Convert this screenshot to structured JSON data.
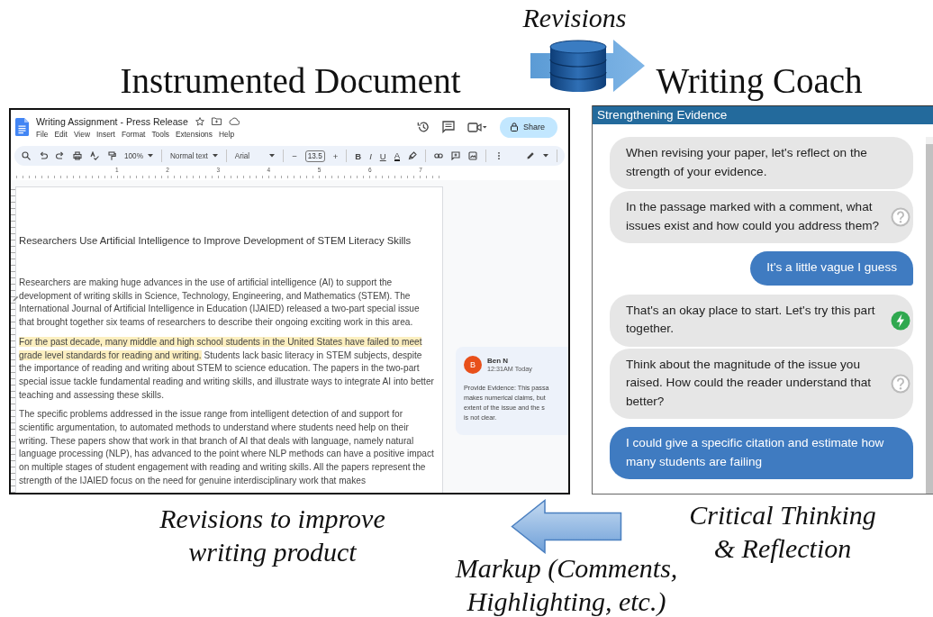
{
  "figure": {
    "top_caption": "Revisions",
    "left_heading": "Instrumented Document",
    "right_heading": "Writing Coach",
    "bottom_left_caption": [
      "Revisions to improve",
      "writing product"
    ],
    "bottom_right_caption": [
      "Critical Thinking",
      "& Reflection"
    ],
    "bottom_caption": [
      "Markup (Comments,",
      "Highlighting, etc.)"
    ]
  },
  "docs": {
    "title": "Writing Assignment - Press Release",
    "menu": [
      "File",
      "Edit",
      "View",
      "Insert",
      "Format",
      "Tools",
      "Extensions",
      "Help"
    ],
    "share_label": "Share",
    "toolbar": {
      "zoom": "100%",
      "style": "Normal text",
      "font": "Arial",
      "minus": "−",
      "font_size": "13.5",
      "plus": "+",
      "bold": "B",
      "italic": "I",
      "underline": "U",
      "text_color": "A"
    },
    "ruler": [
      "1",
      "2",
      "3",
      "4",
      "5",
      "6",
      "7"
    ],
    "document": {
      "heading": "Researchers Use Artificial Intelligence to Improve Development of STEM Literacy Skills",
      "paragraphs": [
        {
          "segments": [
            {
              "text": "Researchers are making huge advances in the use of artificial intelligence (AI) to support the development of writing skills in Science, Technology, Engineering, and Mathematics (STEM). The International Journal of Artificial Intelligence in Education (IJAIED) released a two-part special issue that brought together six teams of researchers to describe their ongoing exciting work in this area.",
              "highlighted": false
            }
          ]
        },
        {
          "segments": [
            {
              "text": "For the past decade, many middle and high school students in the United States have failed to meet grade level standards for reading and writing.",
              "highlighted": true
            },
            {
              "text": " Students lack basic literacy in STEM subjects, despite the importance of reading and writing about STEM to science education. The papers in the two-part special issue tackle fundamental reading and writing skills, and illustrate ways to integrate AI into better teaching and assessing these skills.",
              "highlighted": false
            }
          ]
        },
        {
          "segments": [
            {
              "text": "The specific problems addressed in the issue range from intelligent detection of and support for scientific argumentation, to automated methods to understand where students need help on their writing. These papers show that work in that branch of AI that deals with language, namely natural language processing (NLP), has advanced to the point where NLP methods can have a positive impact on multiple stages of student engagement with reading and writing skills. All the papers represent the strength of the IJAIED focus on the need for genuine interdisciplinary work that makes",
              "highlighted": false
            }
          ]
        }
      ]
    },
    "comment": {
      "avatar": "B",
      "author": "Ben N",
      "time": "12:31AM Today",
      "lines": [
        "Provide Evidence: This passa",
        "makes numerical claims, but",
        "extent of the issue and the s",
        "is not clear."
      ]
    }
  },
  "coach": {
    "title": "Strengthening Evidence",
    "messages": [
      {
        "kind": "prompt",
        "text": "When revising your paper, let's reflect on the strength of your evidence."
      },
      {
        "kind": "question",
        "text": "In the passage marked with a comment, what issues exist and how could you address them?"
      },
      {
        "kind": "reply",
        "text": "It's a little vague I guess"
      },
      {
        "kind": "encouragement",
        "text": "That's an okay place to start. Let's try this part together."
      },
      {
        "kind": "question",
        "text": "Think about the magnitude of the issue you raised. How could the reader understand that better?"
      },
      {
        "kind": "reply",
        "text": "I could give a specific citation and estimate how many students are failing"
      }
    ]
  }
}
